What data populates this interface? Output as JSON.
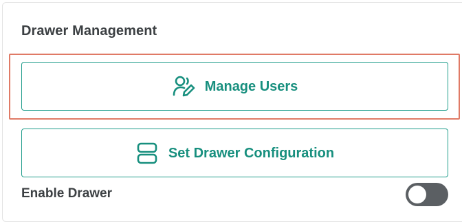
{
  "panel": {
    "title": "Drawer Management"
  },
  "buttons": {
    "manage_users": {
      "label": "Manage Users",
      "icon": "user-edit-icon"
    },
    "set_drawer_configuration": {
      "label": "Set Drawer Configuration",
      "icon": "drawer-stack-icon"
    }
  },
  "enable_drawer": {
    "label": "Enable Drawer",
    "enabled": false
  },
  "colors": {
    "accent": "#178f7e",
    "highlight": "#e07a66",
    "toggle_off": "#5b5f63"
  }
}
